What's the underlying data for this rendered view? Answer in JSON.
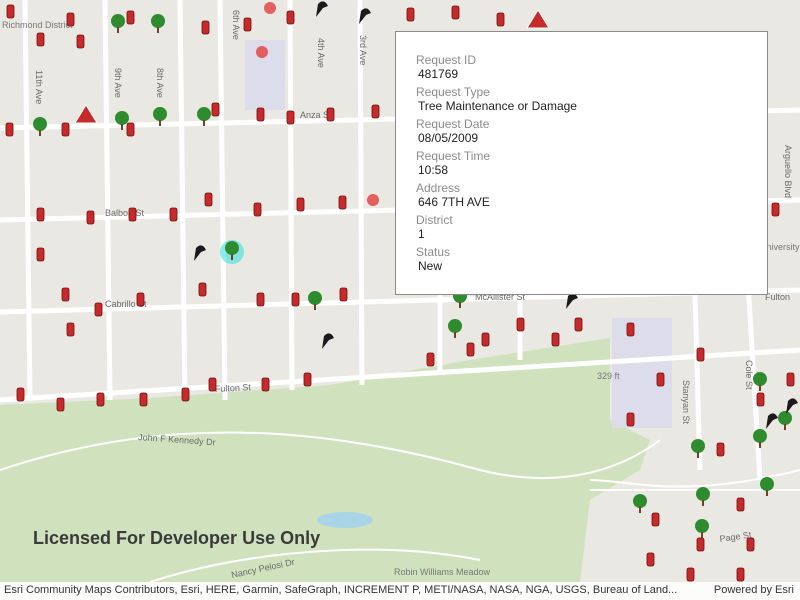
{
  "popup": {
    "fields": [
      {
        "label": "Request ID",
        "value": "481769"
      },
      {
        "label": "Request Type",
        "value": "Tree Maintenance or Damage"
      },
      {
        "label": "Request Date",
        "value": "08/05/2009"
      },
      {
        "label": "Request Time",
        "value": "10:58"
      },
      {
        "label": "Address",
        "value": "646 7TH AVE"
      },
      {
        "label": "District",
        "value": "1"
      },
      {
        "label": "Status",
        "value": "New"
      }
    ]
  },
  "map": {
    "streets": [
      "11th Ave",
      "9th Ave",
      "8th Ave",
      "6th Ave",
      "4th Ave",
      "3rd Ave",
      "Anza St",
      "Balboa St",
      "Cabrillo St",
      "Fulton St",
      "John F Kennedy Dr",
      "Nancy Pelosi Dr",
      "McAllister St",
      "Fulton",
      "Arguello Blvd",
      "Stanyan St",
      "Cole St",
      "Page St"
    ],
    "places": [
      "Richmond District",
      "329 ft",
      "Robin Williams Meadow",
      "University of San Francisco"
    ],
    "symbol_types": [
      "graffiti-icon",
      "tree-icon",
      "hazard-icon",
      "sewer-icon",
      "damaged-icon"
    ]
  },
  "watermark": "Licensed For Developer Use Only",
  "attribution": "Esri Community Maps Contributors, Esri, HERE, Garmin, SafeGraph, INCREMENT P, METI/NASA, NASA, NGA, USGS, Bureau of Land...",
  "powered_by": "Powered by Esri",
  "colors": {
    "park": "#cfe2bd",
    "street": "#ffffff",
    "graffiti": "#c62a2a",
    "tree": "#2e8b2e",
    "highlight": "#40e0e0"
  }
}
